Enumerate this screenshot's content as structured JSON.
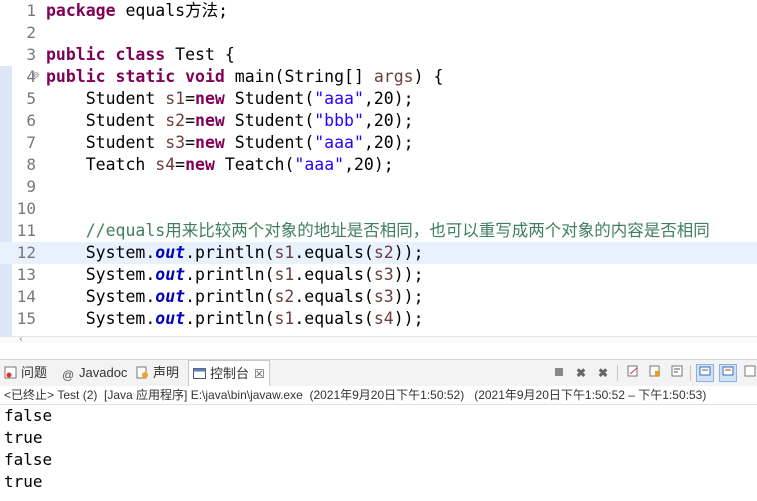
{
  "editor": {
    "lines": [
      {
        "num": "1",
        "tokens": [
          {
            "t": "kw",
            "v": "package"
          },
          {
            "t": "pl",
            "v": " equals方法;"
          }
        ]
      },
      {
        "num": "2",
        "tokens": []
      },
      {
        "num": "3",
        "tokens": [
          {
            "t": "kw",
            "v": "public"
          },
          {
            "t": "pl",
            "v": " "
          },
          {
            "t": "kw",
            "v": "class"
          },
          {
            "t": "pl",
            "v": " Test {"
          }
        ]
      },
      {
        "num": "4",
        "fold": "⊖",
        "tokens": [
          {
            "t": "kw",
            "v": "public"
          },
          {
            "t": "pl",
            "v": " "
          },
          {
            "t": "kw",
            "v": "static"
          },
          {
            "t": "pl",
            "v": " "
          },
          {
            "t": "kw",
            "v": "void"
          },
          {
            "t": "pl",
            "v": " main(String[] "
          },
          {
            "t": "var",
            "v": "args"
          },
          {
            "t": "pl",
            "v": ") {"
          }
        ]
      },
      {
        "num": "5",
        "tokens": [
          {
            "t": "pl",
            "v": "    Student "
          },
          {
            "t": "var",
            "v": "s1"
          },
          {
            "t": "pl",
            "v": "="
          },
          {
            "t": "kw",
            "v": "new"
          },
          {
            "t": "pl",
            "v": " Student("
          },
          {
            "t": "str",
            "v": "\"aaa\""
          },
          {
            "t": "pl",
            "v": ",20);"
          }
        ]
      },
      {
        "num": "6",
        "tokens": [
          {
            "t": "pl",
            "v": "    Student "
          },
          {
            "t": "var",
            "v": "s2"
          },
          {
            "t": "pl",
            "v": "="
          },
          {
            "t": "kw",
            "v": "new"
          },
          {
            "t": "pl",
            "v": " Student("
          },
          {
            "t": "str",
            "v": "\"bbb\""
          },
          {
            "t": "pl",
            "v": ",20);"
          }
        ]
      },
      {
        "num": "7",
        "tokens": [
          {
            "t": "pl",
            "v": "    Student "
          },
          {
            "t": "var",
            "v": "s3"
          },
          {
            "t": "pl",
            "v": "="
          },
          {
            "t": "kw",
            "v": "new"
          },
          {
            "t": "pl",
            "v": " Student("
          },
          {
            "t": "str",
            "v": "\"aaa\""
          },
          {
            "t": "pl",
            "v": ",20);"
          }
        ]
      },
      {
        "num": "8",
        "tokens": [
          {
            "t": "pl",
            "v": "    Teatch "
          },
          {
            "t": "var",
            "v": "s4"
          },
          {
            "t": "pl",
            "v": "="
          },
          {
            "t": "kw",
            "v": "new"
          },
          {
            "t": "pl",
            "v": " Teatch("
          },
          {
            "t": "str",
            "v": "\"aaa\""
          },
          {
            "t": "pl",
            "v": ",20);"
          }
        ]
      },
      {
        "num": "9",
        "tokens": []
      },
      {
        "num": "10",
        "tokens": []
      },
      {
        "num": "11",
        "tokens": [
          {
            "t": "cmt",
            "v": "    //equals用来比较两个对象的地址是否相同，也可以重写成两个对象的内容是否相同"
          }
        ]
      },
      {
        "num": "12",
        "highlight": true,
        "tokens": [
          {
            "t": "pl",
            "v": "    System."
          },
          {
            "t": "fld",
            "v": "out"
          },
          {
            "t": "pl",
            "v": ".println("
          },
          {
            "t": "var",
            "v": "s1"
          },
          {
            "t": "pl",
            "v": ".equals("
          },
          {
            "t": "var",
            "v": "s2"
          },
          {
            "t": "pl",
            "v": "));"
          }
        ]
      },
      {
        "num": "13",
        "tokens": [
          {
            "t": "pl",
            "v": "    System."
          },
          {
            "t": "fld",
            "v": "out"
          },
          {
            "t": "pl",
            "v": ".println("
          },
          {
            "t": "var",
            "v": "s1"
          },
          {
            "t": "pl",
            "v": ".equals("
          },
          {
            "t": "var",
            "v": "s3"
          },
          {
            "t": "pl",
            "v": "));"
          }
        ]
      },
      {
        "num": "14",
        "tokens": [
          {
            "t": "pl",
            "v": "    System."
          },
          {
            "t": "fld",
            "v": "out"
          },
          {
            "t": "pl",
            "v": ".println("
          },
          {
            "t": "var",
            "v": "s2"
          },
          {
            "t": "pl",
            "v": ".equals("
          },
          {
            "t": "var",
            "v": "s3"
          },
          {
            "t": "pl",
            "v": "));"
          }
        ]
      },
      {
        "num": "15",
        "tokens": [
          {
            "t": "pl",
            "v": "    System."
          },
          {
            "t": "fld",
            "v": "out"
          },
          {
            "t": "pl",
            "v": ".println("
          },
          {
            "t": "var",
            "v": "s1"
          },
          {
            "t": "pl",
            "v": ".equals("
          },
          {
            "t": "var",
            "v": "s4"
          },
          {
            "t": "pl",
            "v": "));"
          }
        ]
      }
    ],
    "colors": {
      "keyword": "#7f0055",
      "string": "#2a00ff",
      "variable": "#6a3e3e",
      "field": "#0000c0",
      "comment": "#3f7f5f",
      "highlight": "#e8f2fe"
    }
  },
  "panel": {
    "tabs": [
      {
        "label": "问题",
        "icon": "problems-icon"
      },
      {
        "label": "Javadoc",
        "icon": "at-icon"
      },
      {
        "label": "声明",
        "icon": "declaration-icon"
      },
      {
        "label": "控制台",
        "icon": "console-icon",
        "active": true,
        "close": "☒"
      }
    ],
    "toolbar_icons": [
      "stop-icon",
      "remove-launch-icon",
      "remove-all-icon",
      "clear-console-icon",
      "scroll-lock-icon",
      "word-wrap-icon",
      "show-on-stdout-icon",
      "show-on-stderr-icon",
      "pin-console-icon"
    ],
    "status": "<已终止> Test (2)  [Java 应用程序] E:\\java\\bin\\javaw.exe  (2021年9月20日下午1:50:52)   (2021年9月20日下午1:50:52 – 下午1:50:53)"
  },
  "console": {
    "output": [
      "false",
      "true",
      "false",
      "true"
    ]
  }
}
